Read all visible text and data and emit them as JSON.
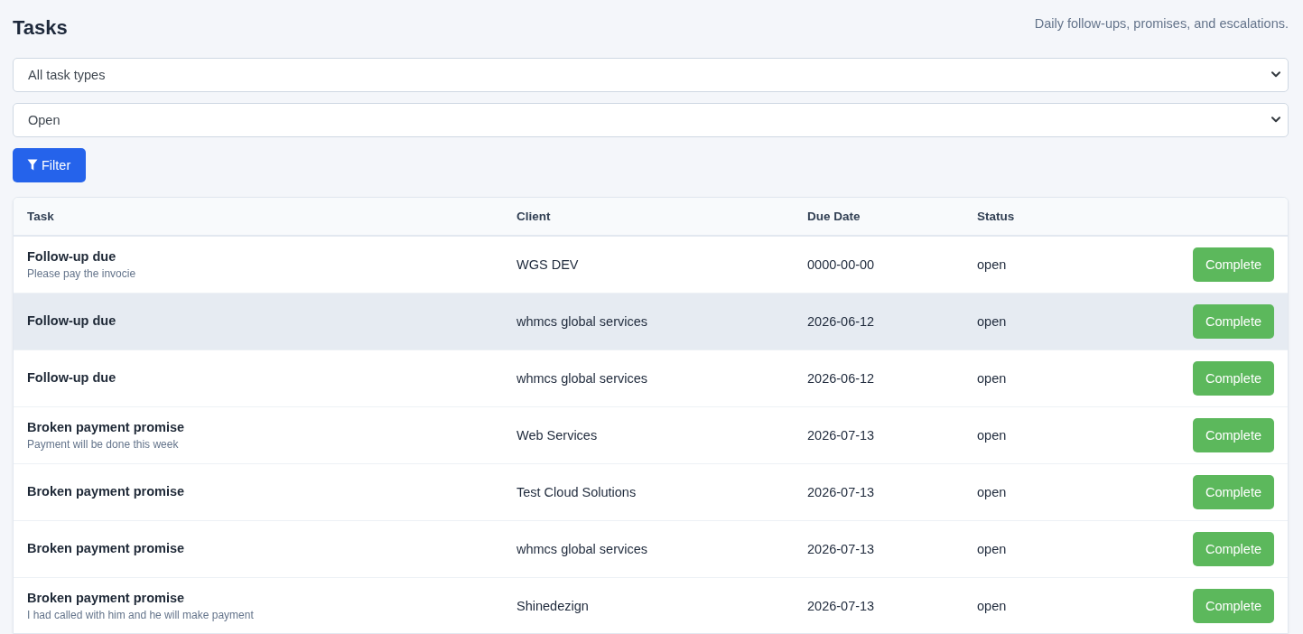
{
  "page": {
    "title": "Tasks",
    "subtitle": "Daily follow-ups, promises, and escalations."
  },
  "filters": {
    "selects": [
      {
        "value": "All task types"
      },
      {
        "value": "Open"
      }
    ],
    "filter_button": {
      "label": "Filter"
    }
  },
  "table": {
    "columns": [
      "Task",
      "Client",
      "Due Date",
      "Status"
    ],
    "rows": [
      {
        "task": "Follow-up due",
        "note": "Please pay the invocie",
        "client": "WGS DEV",
        "due_date": "0000-00-00",
        "status": "open",
        "action": "Complete",
        "hovered": false
      },
      {
        "task": "Follow-up due",
        "client": "whmcs global services",
        "due_date": "2026-06-12",
        "status": "open",
        "action": "Complete",
        "hovered": true
      },
      {
        "task": "Follow-up due",
        "client": "whmcs global services",
        "due_date": "2026-06-12",
        "status": "open",
        "action": "Complete",
        "hovered": false
      },
      {
        "task": "Broken payment promise",
        "note": "Payment will be done this week",
        "client": "Web Services",
        "due_date": "2026-07-13",
        "status": "open",
        "action": "Complete",
        "hovered": false
      },
      {
        "task": "Broken payment promise",
        "client": "Test Cloud Solutions",
        "due_date": "2026-07-13",
        "status": "open",
        "action": "Complete",
        "hovered": false
      },
      {
        "task": "Broken payment promise",
        "client": "whmcs global services",
        "due_date": "2026-07-13",
        "status": "open",
        "action": "Complete",
        "hovered": false
      },
      {
        "task": "Broken payment promise",
        "note": "I had called with him and he will make payment",
        "client": "Shinedezign",
        "due_date": "2026-07-13",
        "status": "open",
        "action": "Complete",
        "hovered": false
      }
    ]
  }
}
